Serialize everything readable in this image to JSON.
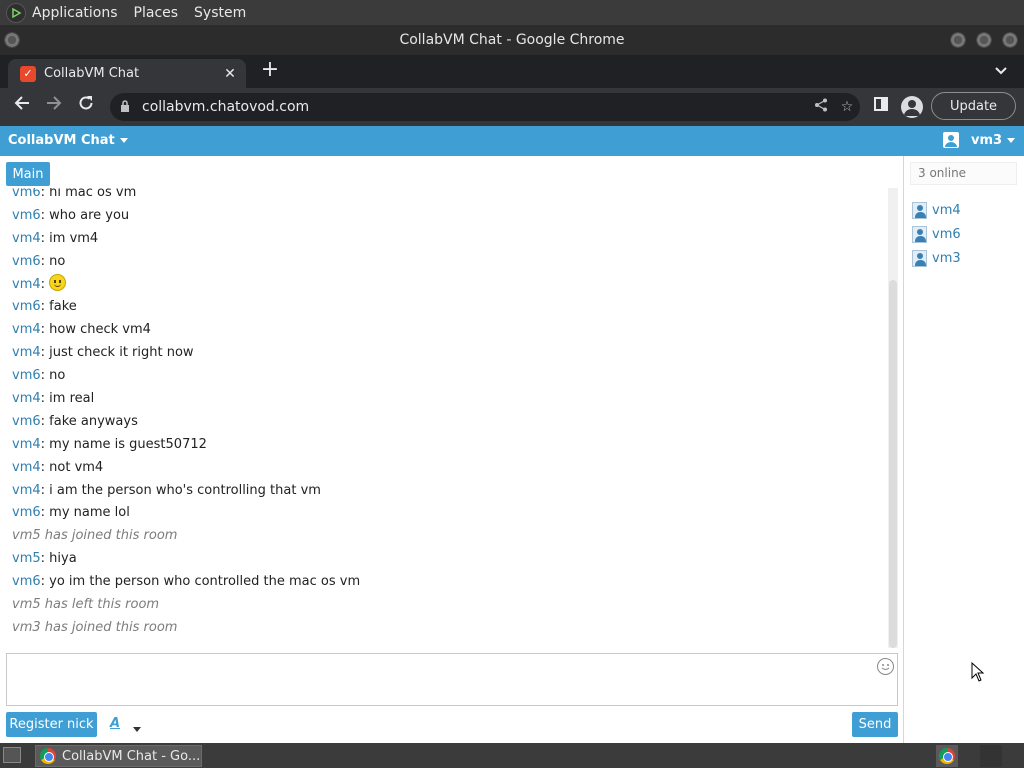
{
  "gnome_panel": {
    "menus": [
      "Applications",
      "Places",
      "System"
    ]
  },
  "window": {
    "title": "CollabVM Chat - Google Chrome"
  },
  "tab": {
    "title": "CollabVM Chat",
    "favicon": "collabvm-logo-icon"
  },
  "toolbar": {
    "url": "collabvm.chatovod.com",
    "update_label": "Update"
  },
  "app": {
    "title": "CollabVM Chat",
    "current_user": "vm3",
    "room_tab": "Main",
    "accent": "#3f9fd4",
    "nick_color": "#2f7fb0",
    "online_count": "3 online",
    "users": [
      "vm4",
      "vm6",
      "vm3"
    ],
    "messages": [
      {
        "nick": "vm6",
        "text": "hi mac os vm"
      },
      {
        "nick": "vm6",
        "text": "who are you"
      },
      {
        "nick": "vm4",
        "text": "im vm4"
      },
      {
        "nick": "vm6",
        "text": "no"
      },
      {
        "nick": "vm4",
        "text": "",
        "emoji": "smiley"
      },
      {
        "nick": "vm6",
        "text": "fake"
      },
      {
        "nick": "vm4",
        "text": "how check vm4"
      },
      {
        "nick": "vm4",
        "text": "just check it right now"
      },
      {
        "nick": "vm6",
        "text": "no"
      },
      {
        "nick": "vm4",
        "text": "im real"
      },
      {
        "nick": "vm6",
        "text": "fake anyways"
      },
      {
        "nick": "vm4",
        "text": "my name is guest50712"
      },
      {
        "nick": "vm4",
        "text": "not vm4"
      },
      {
        "nick": "vm4",
        "text": "i am the person who's controlling that vm"
      },
      {
        "nick": "vm6",
        "text": "my name lol"
      },
      {
        "system": "vm5 has joined this room"
      },
      {
        "nick": "vm5",
        "text": "hiya"
      },
      {
        "nick": "vm6",
        "text": "yo im the person who controlled the mac os vm"
      },
      {
        "system": "vm5 has left this room"
      },
      {
        "system": "vm3 has joined this room"
      }
    ],
    "register_label": "Register nick",
    "format_label": "A",
    "send_label": "Send"
  },
  "taskbar": {
    "task_title": "CollabVM Chat - Go..."
  }
}
